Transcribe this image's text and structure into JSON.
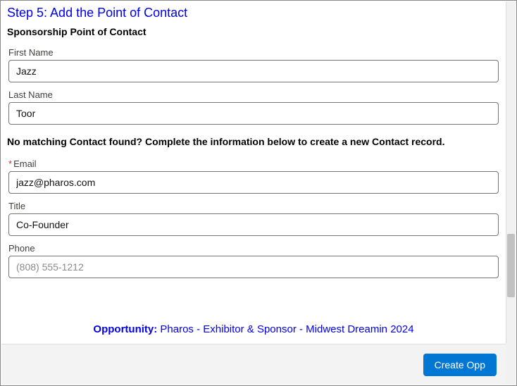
{
  "step": {
    "title": "Step 5: Add the Point of Contact"
  },
  "section": {
    "heading": "Sponsorship Point of Contact"
  },
  "fields": {
    "first_name": {
      "label": "First Name",
      "value": "Jazz"
    },
    "last_name": {
      "label": "Last Name",
      "value": "Toor"
    },
    "helper": "No matching Contact found? Complete the information below to create a new Contact record.",
    "email": {
      "label": "Email",
      "required": "*",
      "value": "jazz@pharos.com"
    },
    "title": {
      "label": "Title",
      "value": "Co-Founder"
    },
    "phone": {
      "label": "Phone",
      "placeholder": "(808) 555-1212",
      "value": ""
    }
  },
  "opportunity": {
    "label": "Opportunity: ",
    "value": "Pharos - Exhibitor & Sponsor - Midwest Dreamin 2024"
  },
  "footer": {
    "create_label": "Create Opp"
  }
}
